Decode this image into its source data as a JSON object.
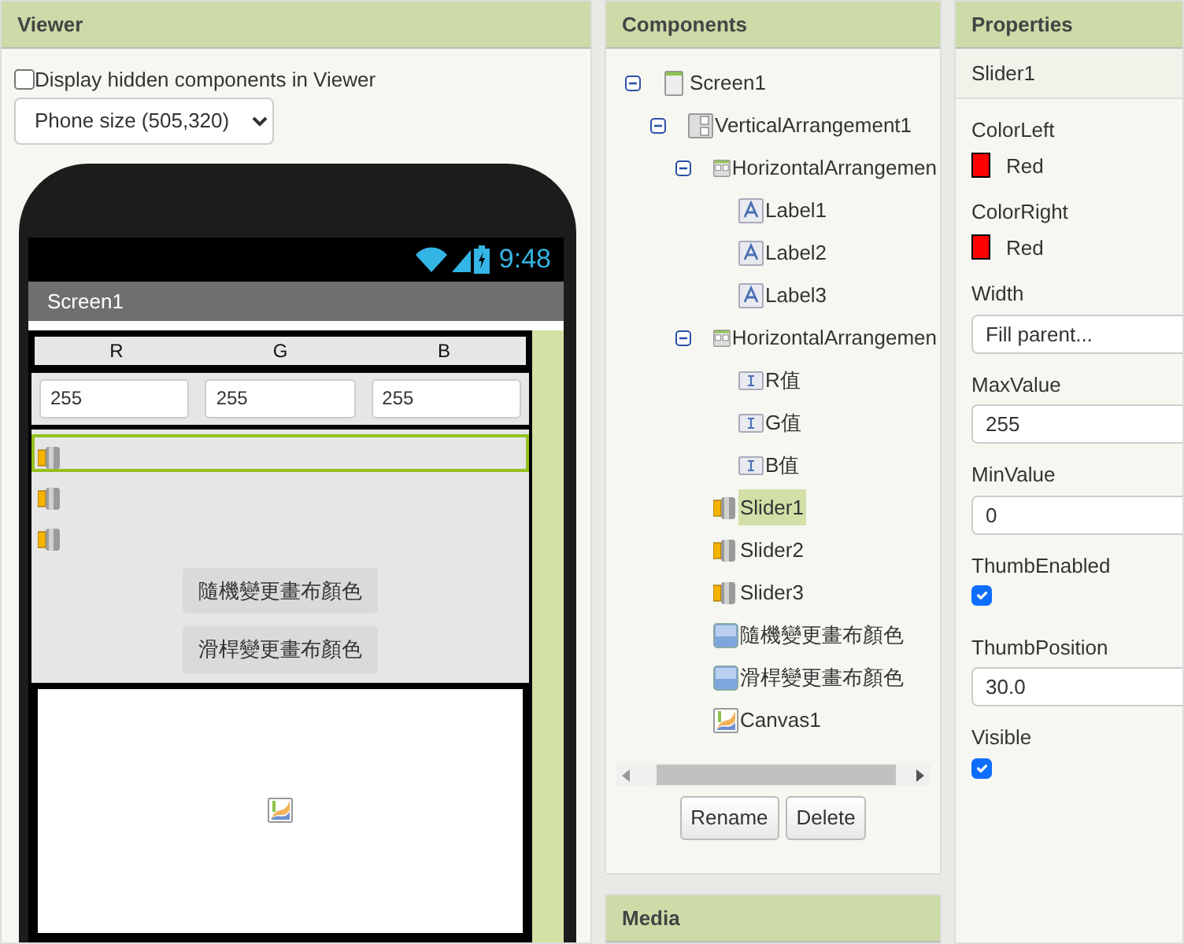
{
  "viewer": {
    "title": "Viewer",
    "hidden_checkbox": {
      "label": "Display hidden components in Viewer",
      "checked": false
    },
    "size_select": {
      "value": "Phone size (505,320)"
    },
    "phone": {
      "time": "9:48",
      "screen_title": "Screen1",
      "labels": [
        "R",
        "G",
        "B"
      ],
      "inputs": [
        "255",
        "255",
        "255"
      ],
      "sliders": [
        {
          "selected": true
        },
        {
          "selected": false
        },
        {
          "selected": false
        }
      ],
      "buttons": [
        "隨機變更畫布顏色",
        "滑桿變更畫布顏色"
      ]
    }
  },
  "components": {
    "title": "Components",
    "tree": [
      {
        "name": "Screen1",
        "kind": "screen",
        "expanded": true,
        "selected": false,
        "children": [
          {
            "name": "VerticalArrangement1",
            "kind": "vertical",
            "expanded": true,
            "selected": false,
            "children": [
              {
                "name": "HorizontalArrangemen",
                "kind": "horizontal",
                "expanded": true,
                "selected": false,
                "children": [
                  {
                    "name": "Label1",
                    "kind": "label",
                    "selected": false
                  },
                  {
                    "name": "Label2",
                    "kind": "label",
                    "selected": false
                  },
                  {
                    "name": "Label3",
                    "kind": "label",
                    "selected": false
                  }
                ]
              },
              {
                "name": "HorizontalArrangemen",
                "kind": "horizontal",
                "expanded": true,
                "selected": false,
                "children": [
                  {
                    "name": "R值",
                    "kind": "textbox",
                    "selected": false
                  },
                  {
                    "name": "G值",
                    "kind": "textbox",
                    "selected": false
                  },
                  {
                    "name": "B值",
                    "kind": "textbox",
                    "selected": false
                  }
                ]
              },
              {
                "name": "Slider1",
                "kind": "slider",
                "selected": true
              },
              {
                "name": "Slider2",
                "kind": "slider",
                "selected": false
              },
              {
                "name": "Slider3",
                "kind": "slider",
                "selected": false
              },
              {
                "name": "隨機變更畫布顏色",
                "kind": "button",
                "selected": false
              },
              {
                "name": "滑桿變更畫布顏色",
                "kind": "button",
                "selected": false
              },
              {
                "name": "Canvas1",
                "kind": "canvas",
                "selected": false
              }
            ]
          }
        ]
      }
    ],
    "buttons": [
      "Rename",
      "Delete"
    ]
  },
  "media": {
    "title": "Media"
  },
  "properties": {
    "title": "Properties",
    "component": "Slider1",
    "items": [
      {
        "kind": "color",
        "label": "ColorLeft",
        "value": "Red",
        "color": "#ff0000"
      },
      {
        "kind": "color",
        "label": "ColorRight",
        "value": "Red",
        "color": "#ff0000"
      },
      {
        "kind": "text",
        "label": "Width",
        "value": "Fill parent..."
      },
      {
        "kind": "text",
        "label": "MaxValue",
        "value": "255"
      },
      {
        "kind": "text",
        "label": "MinValue",
        "value": "0"
      },
      {
        "kind": "check",
        "label": "ThumbEnabled",
        "checked": true
      },
      {
        "kind": "text",
        "label": "ThumbPosition",
        "value": "30.0"
      },
      {
        "kind": "check",
        "label": "Visible",
        "checked": true
      }
    ]
  }
}
